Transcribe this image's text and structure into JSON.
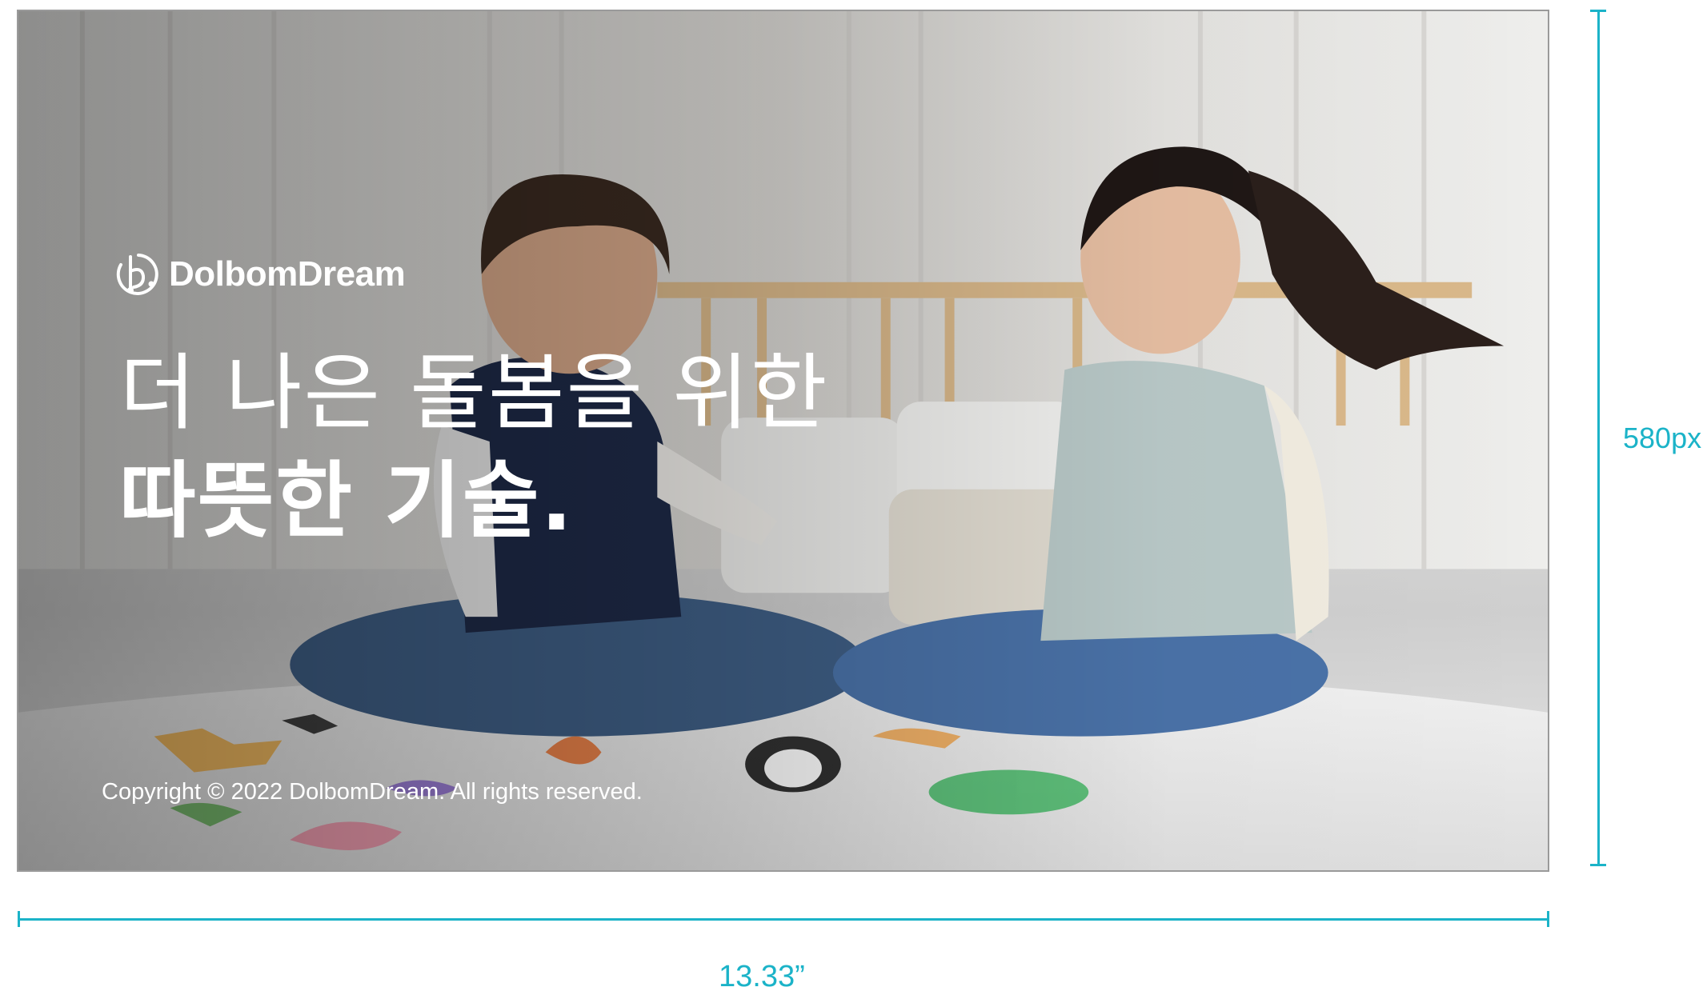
{
  "brand": {
    "logo_text": "DolbomDream",
    "logo_icon": "dolbomdream-logo-mark"
  },
  "headline": {
    "line1": "더 나은 돌봄을 위한",
    "line2": "따뜻한 기술."
  },
  "footer": {
    "copyright": "Copyright © 2022 DolbomDream. All rights reserved."
  },
  "dimensions": {
    "height_label": "580px",
    "width_label": "13.33”"
  },
  "colors": {
    "annotation": "#1bb3c8",
    "overlay_text": "#ffffff"
  }
}
